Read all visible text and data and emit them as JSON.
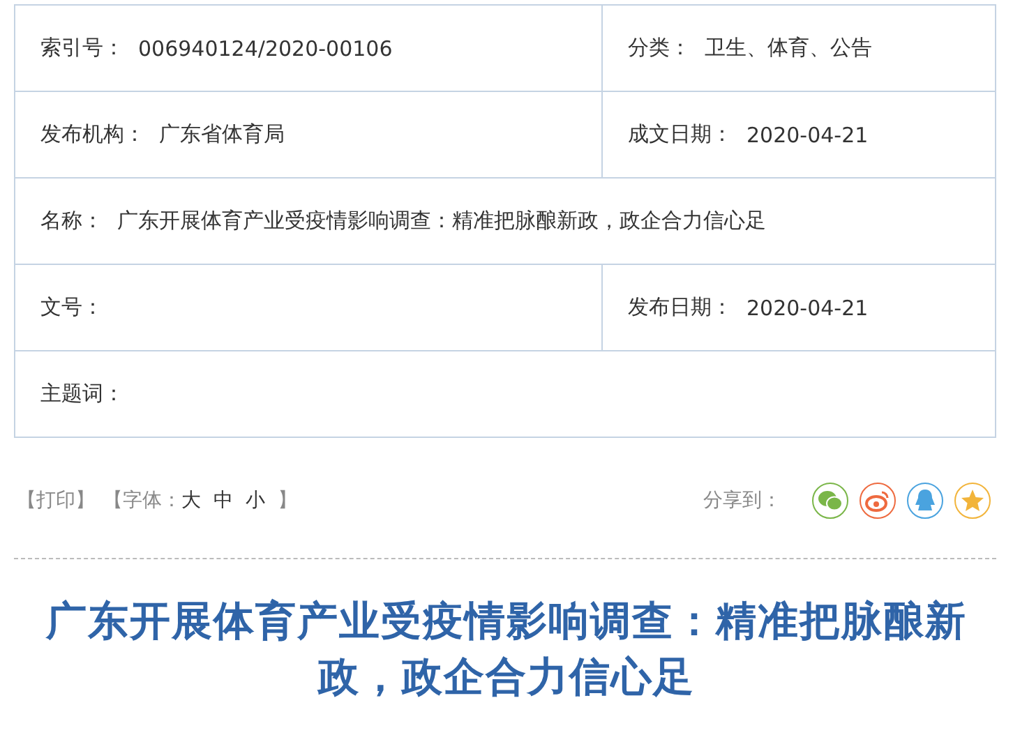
{
  "info_table": {
    "rows": [
      {
        "cells": [
          {
            "label": "索引号：",
            "value": "006940124/2020-00106"
          },
          {
            "label": "分类：",
            "value": "卫生、体育、公告"
          }
        ]
      },
      {
        "cells": [
          {
            "label": "发布机构：",
            "value": "广东省体育局"
          },
          {
            "label": "成文日期：",
            "value": "2020-04-21"
          }
        ]
      },
      {
        "cells": [
          {
            "label": "名称：",
            "value": "广东开展体育产业受疫情影响调查：精准把脉酿新政，政企合力信心足"
          }
        ]
      },
      {
        "cells": [
          {
            "label": "文号："
          },
          {
            "label": "发布日期：",
            "value": "2020-04-21"
          }
        ]
      },
      {
        "cells": [
          {
            "label": "主题词："
          }
        ]
      }
    ]
  },
  "toolbar": {
    "print_link": "【打印】",
    "font_size_label": "【字体：",
    "font_sizes": [
      "大",
      "中",
      "小"
    ],
    "font_size_end": "】",
    "share_label": "分享到：",
    "share_buttons": [
      {
        "kind": "wechat",
        "color": "#7ab648"
      },
      {
        "kind": "weibo",
        "color": "#ee6a3f"
      },
      {
        "kind": "qq",
        "color": "#4aa3df"
      },
      {
        "kind": "star",
        "color": "#f2b43a"
      }
    ]
  },
  "article": {
    "title": "广东开展体育产业受疫情影响调查：精准把脉酿新政，政企合力信心足"
  }
}
